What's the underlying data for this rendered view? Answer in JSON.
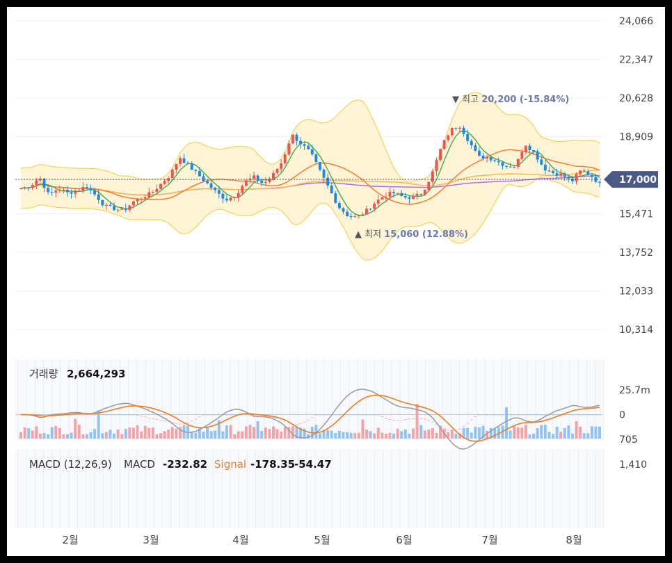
{
  "colors": {
    "up": "#ef5350",
    "down": "#1e88e5",
    "up_vol": "#f4a2a6",
    "down_vol": "#90c2f5",
    "ma5": "#4caf50",
    "ma20": "#ff7b2e",
    "ma60": "#ffb74d",
    "ma120": "#b06ee0",
    "band_fill": "#fff5d6",
    "band_line": "#f3d25a",
    "macd_line": "#9e9e9e",
    "signal_line": "#ef7d22",
    "badge": "#4a5a85"
  },
  "chart_data": [
    {
      "type": "candlestick",
      "x_axis": {
        "labels": [
          "2월",
          "3월",
          "4월",
          "5월",
          "6월",
          "7월",
          "8월"
        ]
      },
      "y_axis": {
        "ticks": [
          "24,066",
          "22,347",
          "20,628",
          "18,909",
          "17,000",
          "15,471",
          "13,752",
          "12,033",
          "10,314"
        ],
        "range": [
          10314,
          24066
        ]
      },
      "current_price": "17,000",
      "annotations": {
        "high": {
          "marker": "▼",
          "label": "최고",
          "value": "20,200 (-15.84%)"
        },
        "low": {
          "marker": "▲",
          "label": "최저",
          "value": "15,060 (12.88%)"
        }
      },
      "key_points": {
        "close": [
          16600,
          16700,
          17100,
          16300,
          16600,
          16400,
          16500,
          16700,
          16300,
          15800,
          15700,
          15600,
          16000,
          16200,
          16400,
          16800,
          17200,
          18000,
          17600,
          17200,
          16800,
          16400,
          16100,
          16300,
          16900,
          17100,
          16800,
          17200,
          17800,
          19000,
          18600,
          18200,
          17400,
          16600,
          15800,
          15400,
          15300,
          15600,
          16000,
          16300,
          16400,
          16200,
          16200,
          16400,
          17200,
          18400,
          19200,
          19400,
          18700,
          18000,
          18000,
          17800,
          17600,
          17600,
          18600,
          18200,
          17500,
          17300,
          17200,
          16900,
          17400,
          17200,
          16800
        ],
        "ma_labels_shown": false
      }
    },
    {
      "type": "bar",
      "title": "거래량",
      "current": "2,664,293",
      "y_axis": {
        "ticks": [
          "25.7m"
        ]
      }
    },
    {
      "type": "line",
      "title": "MACD (12,26,9)",
      "macd_label": "MACD",
      "macd_value": "-232.82",
      "signal_label": "Signal",
      "signal_value": "-178.35",
      "hist_value": "-54.47",
      "y_axis": {
        "ticks": [
          "1,410",
          "705",
          "0"
        ],
        "range": [
          -400,
          1410
        ]
      }
    }
  ]
}
